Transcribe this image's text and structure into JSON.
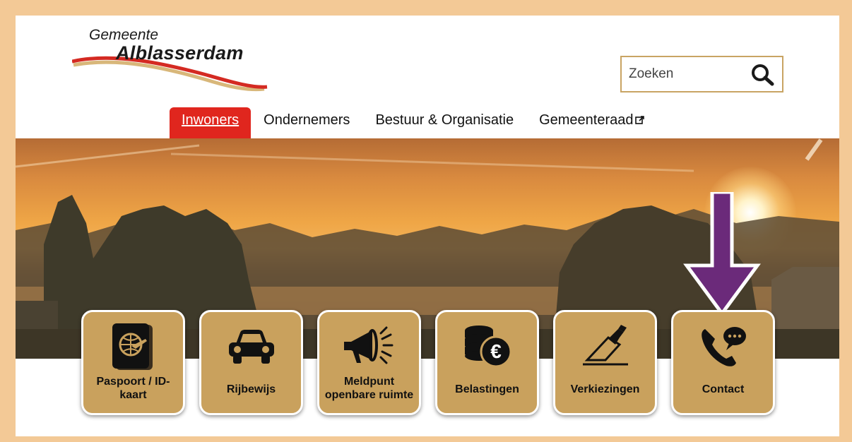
{
  "logo": {
    "line1": "Gemeente",
    "line2": "Alblasserdam"
  },
  "search": {
    "placeholder": "Zoeken",
    "icon": "search-icon"
  },
  "nav": {
    "items": [
      {
        "label": "Inwoners",
        "active": true
      },
      {
        "label": "Ondernemers",
        "active": false
      },
      {
        "label": "Bestuur & Organisatie",
        "active": false
      },
      {
        "label": "Gemeenteraad",
        "active": false,
        "external": true
      }
    ]
  },
  "tiles": [
    {
      "label": "Paspoort / ID-kaart",
      "icon": "passport-icon"
    },
    {
      "label": "Rijbewijs",
      "icon": "car-icon"
    },
    {
      "label": "Meldpunt openbare ruimte",
      "icon": "megaphone-icon"
    },
    {
      "label": "Belastingen",
      "icon": "coins-euro-icon"
    },
    {
      "label": "Verkiezingen",
      "icon": "ballot-icon"
    },
    {
      "label": "Contact",
      "icon": "phone-chat-icon"
    }
  ],
  "colors": {
    "accent_red": "#e0261e",
    "tile_gold": "#c9a15d",
    "frame_border": "#f3c996",
    "arrow_purple": "#6b2a7a"
  }
}
